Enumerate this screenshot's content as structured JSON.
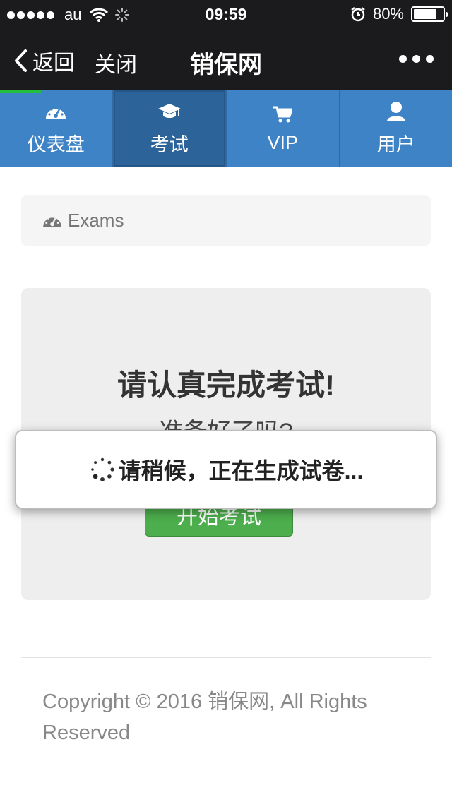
{
  "status_bar": {
    "carrier": "au",
    "time": "09:59",
    "battery_percent": "80%",
    "battery_level": 0.8,
    "icons": [
      "signal-dots-icon",
      "wifi-icon",
      "activity-spinner-icon",
      "alarm-clock-icon",
      "battery-icon"
    ]
  },
  "nav": {
    "back_label": "返回",
    "close_label": "关闭",
    "title": "销保网",
    "more_icon": "more-dots-icon",
    "load_progress": 0.09
  },
  "tabs": [
    {
      "label": "仪表盘",
      "icon": "dashboard-gauge-icon",
      "active": false
    },
    {
      "label": "考试",
      "icon": "graduation-cap-icon",
      "active": true
    },
    {
      "label": "VIP",
      "icon": "shopping-cart-icon",
      "active": false
    },
    {
      "label": "用户",
      "icon": "user-icon",
      "active": false
    }
  ],
  "breadcrumb": {
    "icon": "dashboard-gauge-icon",
    "label": "Exams"
  },
  "jumbotron": {
    "title": "请认真完成考试!",
    "subtitle": "准备好了吗?",
    "start_button": "开始考试"
  },
  "footer": {
    "copyright": "Copyright © 2016 销保网, All Rights Reserved"
  },
  "toast": {
    "message": "请稍候，正在生成试卷...",
    "icon": "loading-spinner-icon"
  },
  "colors": {
    "nav_bg": "#1b1b1d",
    "tab_bg": "#3e83c6",
    "tab_active_bg": "#2c6399",
    "progress": "#22c03c",
    "start_button": "#4cae4c"
  }
}
